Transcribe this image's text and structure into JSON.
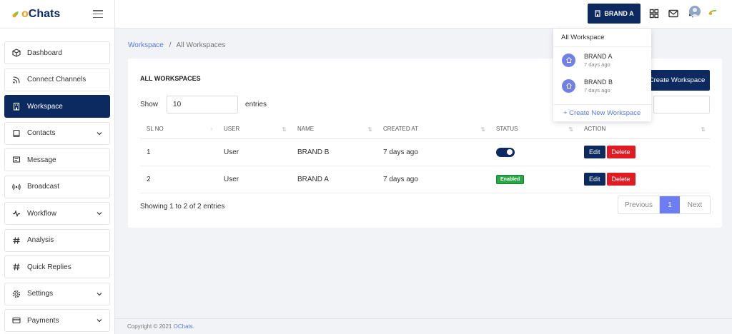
{
  "app": {
    "logo_text": "Chats",
    "logo_accent": "o",
    "accent_color": "#0c2a5f",
    "primary_button_color": "#6d7ef5",
    "danger_color": "#e01b22",
    "success_color": "#28a745"
  },
  "sidebar": {
    "items": [
      {
        "label": "Dashboard",
        "icon": "cube-icon",
        "has_chevron": false
      },
      {
        "label": "Connect Channels",
        "icon": "rss-icon",
        "has_chevron": false
      },
      {
        "label": "Workspace",
        "icon": "building-icon",
        "has_chevron": false,
        "active": true
      },
      {
        "label": "Contacts",
        "icon": "book-icon",
        "has_chevron": true
      },
      {
        "label": "Message",
        "icon": "message-icon",
        "has_chevron": false
      },
      {
        "label": "Broadcast",
        "icon": "broadcast-icon",
        "has_chevron": false
      },
      {
        "label": "Workflow",
        "icon": "activity-icon",
        "has_chevron": true
      },
      {
        "label": "Analysis",
        "icon": "hash-icon",
        "has_chevron": false
      },
      {
        "label": "Quick Replies",
        "icon": "hash-icon",
        "has_chevron": false
      },
      {
        "label": "Settings",
        "icon": "gear-icon",
        "has_chevron": true
      },
      {
        "label": "Payments",
        "icon": "card-icon",
        "has_chevron": true
      }
    ]
  },
  "topbar": {
    "brand_button_label": "BRAND A"
  },
  "dropdown": {
    "header": "All Workspace",
    "items": [
      {
        "name": "BRAND A",
        "time": "7 days ago"
      },
      {
        "name": "BRAND B",
        "time": "7 days ago"
      }
    ],
    "create_label": "+  Create New Workspace"
  },
  "breadcrumb": {
    "link": "Workspace",
    "separator": "/",
    "current": "All Workspaces"
  },
  "card": {
    "title": "ALL WORKSPACES",
    "create_button": "Create Workspace",
    "show_label": "Show",
    "entries_value": "10",
    "entries_label": "entries"
  },
  "table": {
    "headers": [
      "SL NO",
      "USER",
      "NAME",
      "CREATED AT",
      "STATUS",
      "ACTION"
    ],
    "rows": [
      {
        "sl": "1",
        "user": "User",
        "name": "BRAND B",
        "created": "7 days ago",
        "status": "toggle",
        "edit": "Edit",
        "delete": "Delete"
      },
      {
        "sl": "2",
        "user": "User",
        "name": "BRAND A",
        "created": "7 days ago",
        "status": "Enabled",
        "edit": "Edit",
        "delete": "Delete"
      }
    ]
  },
  "pagination": {
    "showing": "Showing 1 to 2 of 2 entries",
    "previous": "Previous",
    "current_page": "1",
    "next": "Next"
  },
  "footer": {
    "text": "Copyright © 2021 ",
    "link": "OChats",
    "suffix": "."
  }
}
